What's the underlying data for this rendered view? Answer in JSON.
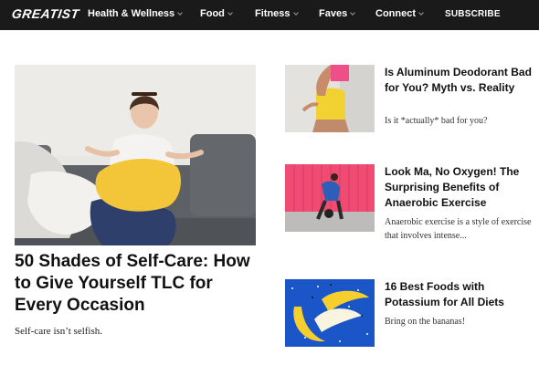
{
  "header": {
    "logo": "GREATIST",
    "nav": [
      {
        "label": "Health & Wellness"
      },
      {
        "label": "Food"
      },
      {
        "label": "Fitness"
      },
      {
        "label": "Faves"
      },
      {
        "label": "Connect"
      }
    ],
    "subscribe": "SUBSCRIBE"
  },
  "hero": {
    "title": "50 Shades of Self-Care: How to Give Yourself TLC for Every Occasion",
    "subtitle": "Self-care isn’t selfish."
  },
  "cards": [
    {
      "title": "Is Aluminum Deodorant Bad for You? Myth vs. Reality",
      "subtitle": "Is it *actually* bad for you?"
    },
    {
      "title": "Look Ma, No Oxygen! The Surprising Benefits of Anaerobic Exercise",
      "subtitle": "Anaerobic exercise is a style of exercise that involves intense..."
    },
    {
      "title": "16 Best Foods with Potassium for All Diets",
      "subtitle": "Bring on the bananas!"
    }
  ]
}
